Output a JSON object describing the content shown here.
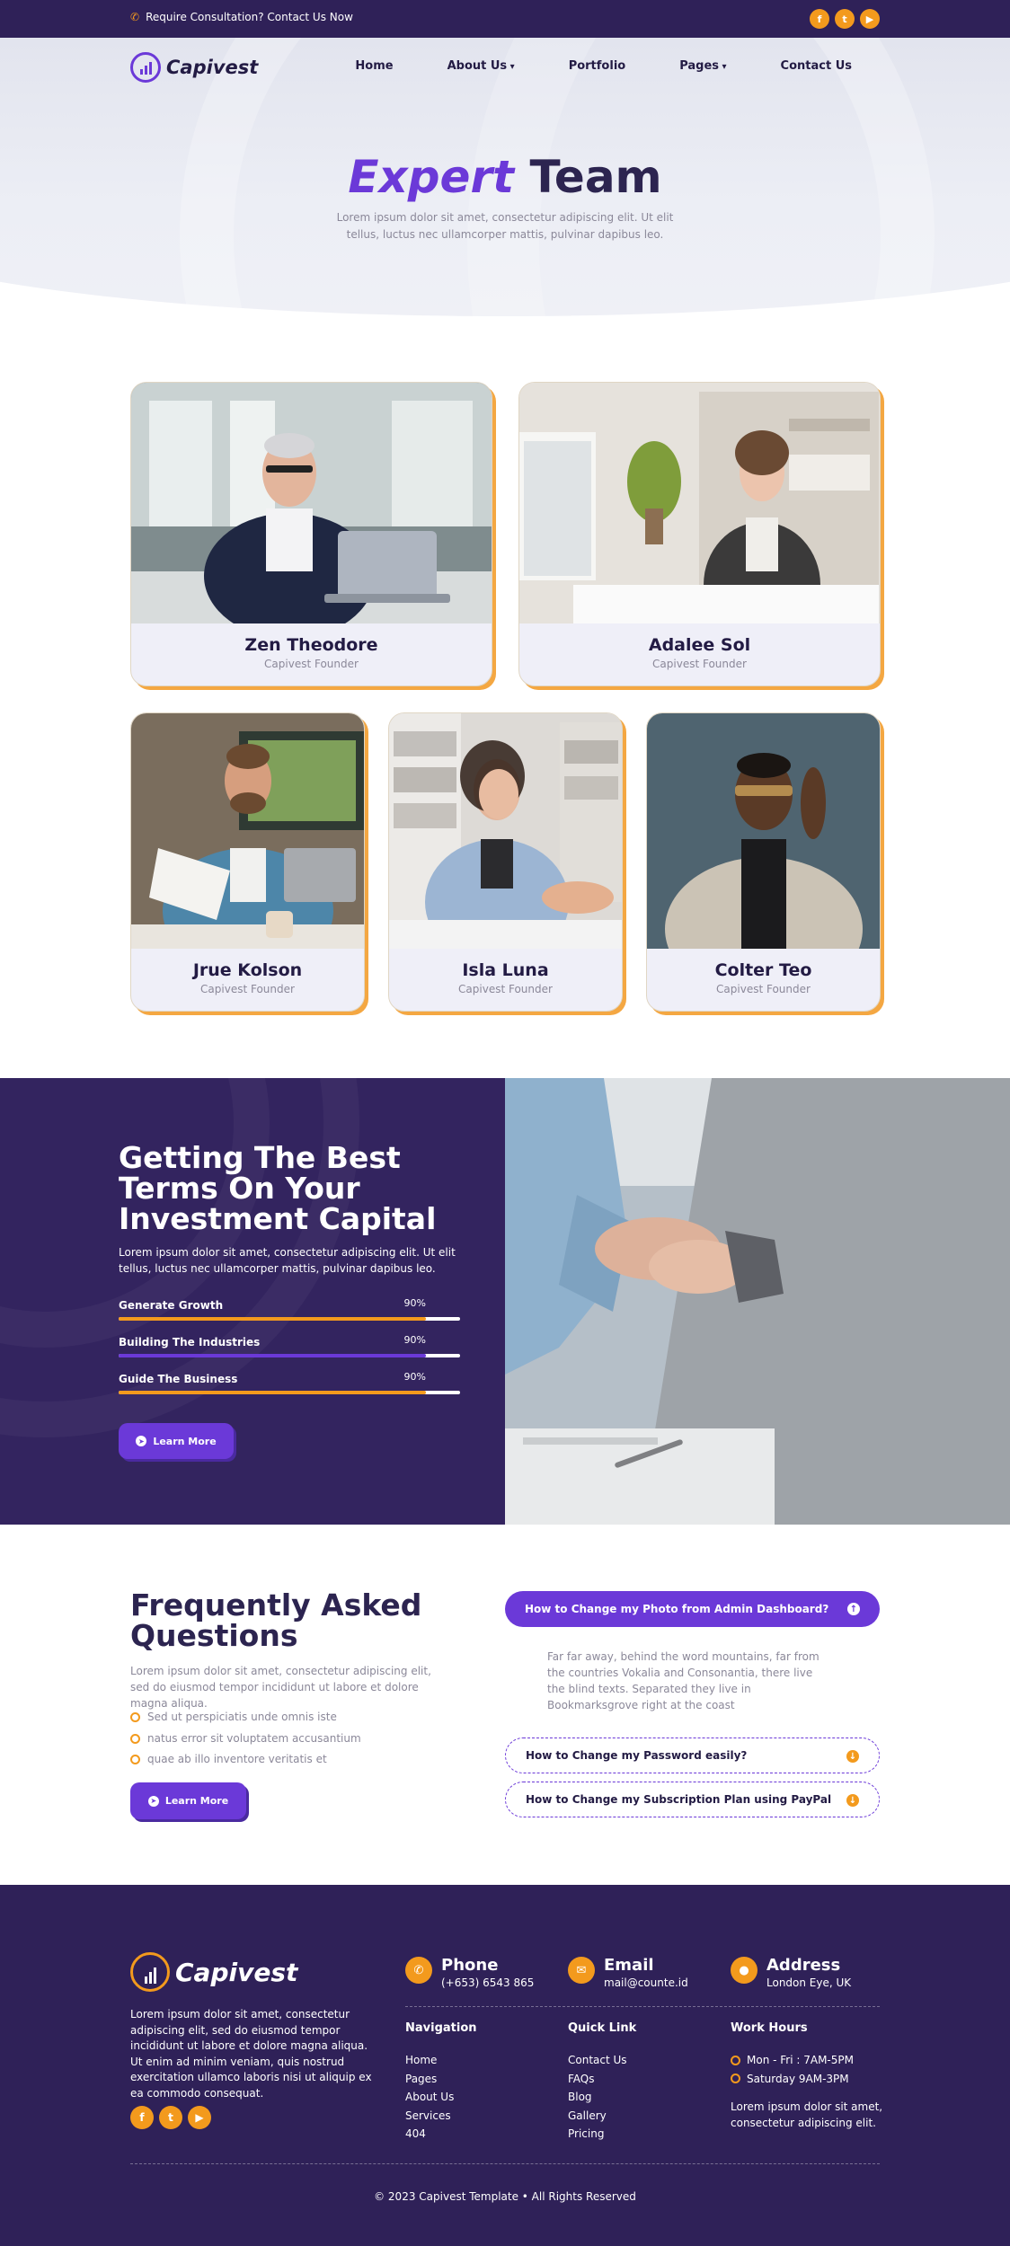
{
  "topbar": {
    "contact_text": "Require Consultation? Contact Us Now",
    "socials": [
      "facebook-icon",
      "twitter-icon",
      "youtube-icon"
    ]
  },
  "brand": {
    "name": "Capivest",
    "accent": "#6b39d8",
    "orange": "#f39a1d",
    "navy": "#2f2158"
  },
  "nav": {
    "items": [
      {
        "label": "Home"
      },
      {
        "label": "About Us",
        "dropdown": true
      },
      {
        "label": "Portfolio"
      },
      {
        "label": "Pages",
        "dropdown": true
      },
      {
        "label": "Contact Us"
      }
    ]
  },
  "hero": {
    "title_accent": "Expert",
    "title_rest": "Team",
    "subtitle": "Lorem ipsum dolor sit amet, consectetur adipiscing elit. Ut elit tellus, luctus nec ullamcorper mattis, pulvinar dapibus leo."
  },
  "team": [
    {
      "name": "Zen Theodore",
      "role": "Capivest Founder"
    },
    {
      "name": "Adalee Sol",
      "role": "Capivest Founder"
    },
    {
      "name": "Jrue Kolson",
      "role": "Capivest Founder"
    },
    {
      "name": "Isla Luna",
      "role": "Capivest Founder"
    },
    {
      "name": "Colter Teo",
      "role": "Capivest Founder"
    }
  ],
  "stats": {
    "title": "Getting The Best Terms On Your Investment Capital",
    "text": "Lorem ipsum dolor sit amet, consectetur adipiscing elit. Ut elit tellus, luctus nec ullamcorper mattis, pulvinar dapibus leo.",
    "bars": [
      {
        "label": "Generate Growth",
        "percent_label": "90%",
        "value": 0.9,
        "color": "#f39a1d"
      },
      {
        "label": "Building The Industries",
        "percent_label": "90%",
        "value": 0.9,
        "color": "#6b39d8"
      },
      {
        "label": "Guide The Business",
        "percent_label": "90%",
        "value": 0.9,
        "color": "#f39a1d"
      }
    ],
    "button": "Learn More"
  },
  "faq": {
    "title": "Frequently Asked Questions",
    "text": "Lorem ipsum dolor sit amet, consectetur adipiscing elit, sed do eiusmod tempor incididunt ut labore et dolore magna aliqua.",
    "list": [
      "Sed ut perspiciatis unde omnis iste",
      "natus error sit voluptatem accusantium",
      "quae ab illo inventore veritatis et"
    ],
    "button": "Learn More",
    "items": [
      {
        "question": "How to Change my Photo from Admin Dashboard?",
        "open": true,
        "answer": "Far far away, behind the word mountains, far from the countries Vokalia and Consonantia, there live the blind texts. Separated they live in Bookmarksgrove right at the coast"
      },
      {
        "question": "How to Change my Password easily?",
        "open": false
      },
      {
        "question": "How to Change my Subscription Plan using PayPal",
        "open": false
      }
    ]
  },
  "footer": {
    "about": "Lorem ipsum dolor sit amet, consectetur adipiscing elit, sed do eiusmod tempor incididunt ut labore et dolore magna aliqua. Ut enim ad minim veniam, quis nostrud exercitation ullamco laboris nisi ut aliquip ex ea commodo consequat.",
    "phone": {
      "title": "Phone",
      "value": "(+653) 6543 865"
    },
    "email": {
      "title": "Email",
      "value": "mail@counte.id"
    },
    "address": {
      "title": "Address",
      "value": "London Eye, UK"
    },
    "navigation": {
      "title": "Navigation",
      "links": [
        "Home",
        "Pages",
        "About Us",
        "Services",
        "404"
      ]
    },
    "quick_link": {
      "title": "Quick Link",
      "links": [
        "Contact Us",
        "FAQs",
        "Blog",
        "Gallery",
        "Pricing"
      ]
    },
    "work_hours": {
      "title": "Work Hours",
      "hours": [
        "Mon - Fri : 7AM-5PM",
        "Saturday 9AM-3PM"
      ],
      "note": "Lorem ipsum dolor sit amet, consectetur adipiscing elit."
    },
    "copyright": "© 2023 Capivest Template • All Rights Reserved"
  }
}
